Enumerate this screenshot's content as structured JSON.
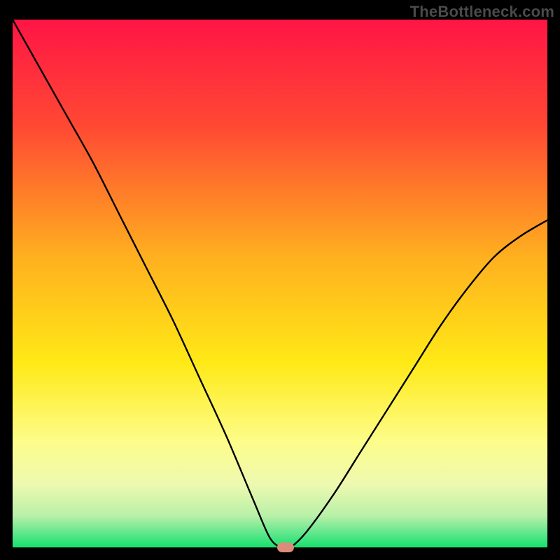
{
  "attribution": "TheBottleneck.com",
  "chart_data": {
    "type": "line",
    "title": "",
    "xlabel": "",
    "ylabel": "",
    "xlim": [
      0,
      100
    ],
    "ylim": [
      0,
      100
    ],
    "x": [
      0,
      5,
      10,
      15,
      20,
      25,
      30,
      35,
      40,
      45,
      48,
      50,
      51,
      52,
      55,
      60,
      65,
      70,
      75,
      80,
      85,
      90,
      95,
      100
    ],
    "values": [
      100,
      91,
      82,
      73,
      63,
      53,
      43,
      32,
      21,
      9,
      2,
      0,
      0,
      0,
      3,
      10,
      18,
      26,
      34,
      42,
      49,
      55,
      59,
      62
    ],
    "marker": {
      "x": 51,
      "y": 0
    },
    "gradient_stops": [
      {
        "pct": 0,
        "color": "#ff1545"
      },
      {
        "pct": 20,
        "color": "#ff4833"
      },
      {
        "pct": 45,
        "color": "#ffb01f"
      },
      {
        "pct": 65,
        "color": "#ffe916"
      },
      {
        "pct": 80,
        "color": "#fdfd8a"
      },
      {
        "pct": 88,
        "color": "#eef9b0"
      },
      {
        "pct": 94,
        "color": "#b9f0a8"
      },
      {
        "pct": 98,
        "color": "#4de585"
      },
      {
        "pct": 100,
        "color": "#16e26d"
      }
    ]
  }
}
